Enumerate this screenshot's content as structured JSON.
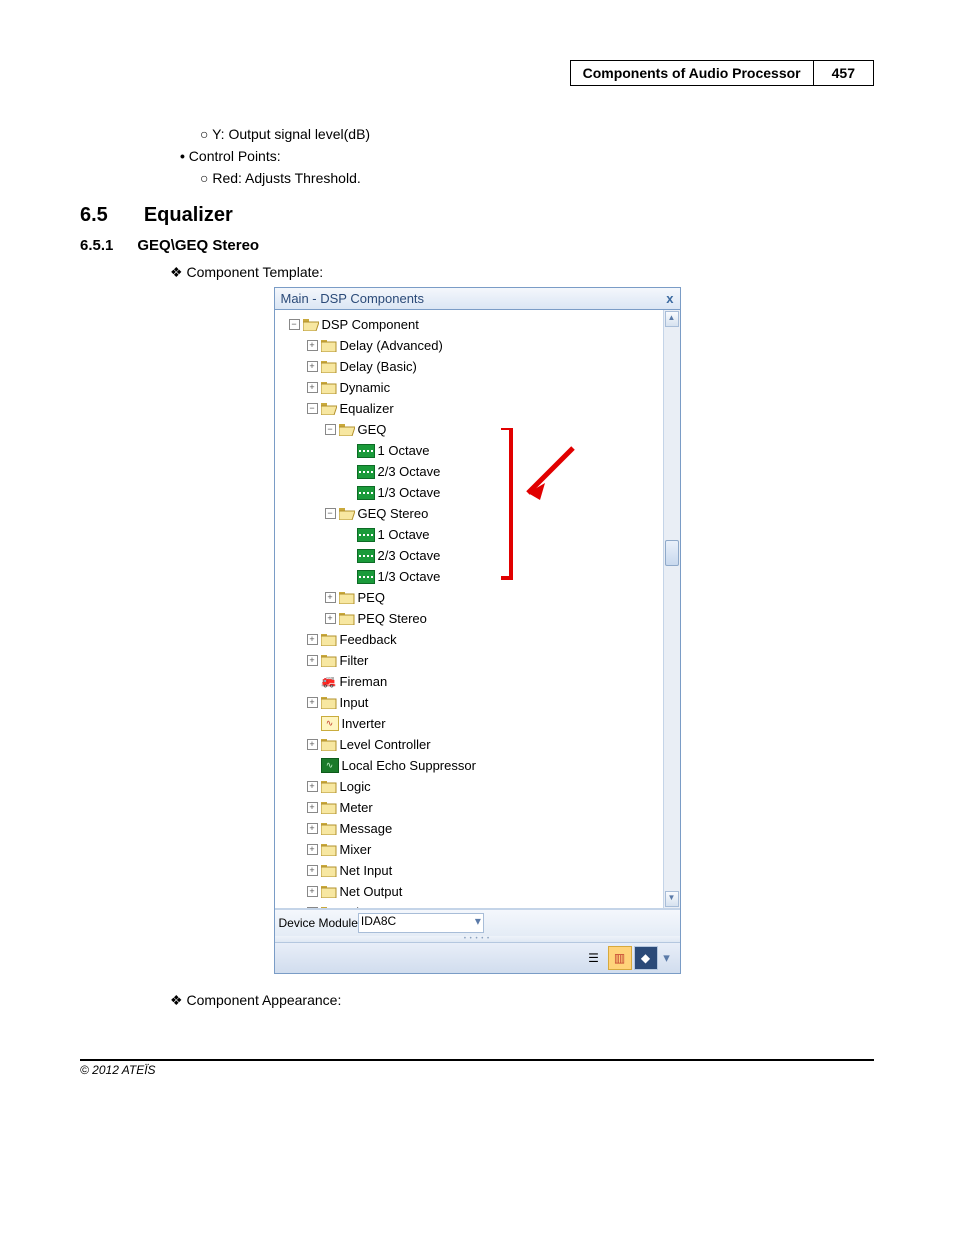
{
  "header": {
    "title": "Components of Audio Processor",
    "page": "457"
  },
  "bullets": {
    "y_line": "Y: Output signal level(dB)",
    "control_points": "Control Points:",
    "red_line": "Red: Adjusts Threshold."
  },
  "section": {
    "num": "6.5",
    "title": "Equalizer"
  },
  "subsection": {
    "num": "6.5.1",
    "title": "GEQ\\GEQ Stereo"
  },
  "labels": {
    "component_template": "Component Template:",
    "component_appearance": "Component Appearance:"
  },
  "panel": {
    "title": "Main - DSP Components",
    "close_glyph": "x",
    "device_label": "Device Module",
    "device_value": "IDA8C",
    "toolbar_icons": [
      "list-icon",
      "columns-icon",
      "picture-icon"
    ]
  },
  "tree": [
    {
      "d": 0,
      "exp": "-",
      "icon": "folder-open",
      "label": "DSP Component"
    },
    {
      "d": 1,
      "exp": "+",
      "icon": "folder-closed",
      "label": "Delay (Advanced)"
    },
    {
      "d": 1,
      "exp": "+",
      "icon": "folder-closed",
      "label": "Delay (Basic)"
    },
    {
      "d": 1,
      "exp": "+",
      "icon": "folder-closed",
      "label": "Dynamic"
    },
    {
      "d": 1,
      "exp": "-",
      "icon": "folder-open",
      "label": "Equalizer"
    },
    {
      "d": 2,
      "exp": "-",
      "icon": "folder-open",
      "label": "GEQ"
    },
    {
      "d": 3,
      "exp": "",
      "icon": "leaf-eq",
      "label": "1 Octave"
    },
    {
      "d": 3,
      "exp": "",
      "icon": "leaf-eq",
      "label": "2/3 Octave"
    },
    {
      "d": 3,
      "exp": "",
      "icon": "leaf-eq",
      "label": "1/3 Octave"
    },
    {
      "d": 2,
      "exp": "-",
      "icon": "folder-open",
      "label": "GEQ Stereo"
    },
    {
      "d": 3,
      "exp": "",
      "icon": "leaf-eq",
      "label": "1 Octave"
    },
    {
      "d": 3,
      "exp": "",
      "icon": "leaf-eq",
      "label": "2/3 Octave"
    },
    {
      "d": 3,
      "exp": "",
      "icon": "leaf-eq",
      "label": "1/3 Octave"
    },
    {
      "d": 2,
      "exp": "+",
      "icon": "folder-closed",
      "label": "PEQ"
    },
    {
      "d": 2,
      "exp": "+",
      "icon": "folder-closed",
      "label": "PEQ Stereo"
    },
    {
      "d": 1,
      "exp": "+",
      "icon": "folder-closed",
      "label": "Feedback"
    },
    {
      "d": 1,
      "exp": "+",
      "icon": "folder-closed",
      "label": "Filter"
    },
    {
      "d": 1,
      "exp": "",
      "icon": "leaf-fireman",
      "label": "Fireman"
    },
    {
      "d": 1,
      "exp": "+",
      "icon": "folder-closed",
      "label": "Input"
    },
    {
      "d": 1,
      "exp": "",
      "icon": "leaf-wave-yellow",
      "label": "Inverter"
    },
    {
      "d": 1,
      "exp": "+",
      "icon": "folder-closed",
      "label": "Level Controller"
    },
    {
      "d": 1,
      "exp": "",
      "icon": "leaf-wave-green",
      "label": "Local Echo Suppressor"
    },
    {
      "d": 1,
      "exp": "+",
      "icon": "folder-closed",
      "label": "Logic"
    },
    {
      "d": 1,
      "exp": "+",
      "icon": "folder-closed",
      "label": "Meter"
    },
    {
      "d": 1,
      "exp": "+",
      "icon": "folder-closed",
      "label": "Message"
    },
    {
      "d": 1,
      "exp": "+",
      "icon": "folder-closed",
      "label": "Mixer"
    },
    {
      "d": 1,
      "exp": "+",
      "icon": "folder-closed",
      "label": "Net Input"
    },
    {
      "d": 1,
      "exp": "+",
      "icon": "folder-closed",
      "label": "Net Output"
    },
    {
      "d": 1,
      "exp": "+",
      "icon": "folder-closed",
      "label": "Noise Generator"
    }
  ],
  "footer": "© 2012 ATEÏS"
}
